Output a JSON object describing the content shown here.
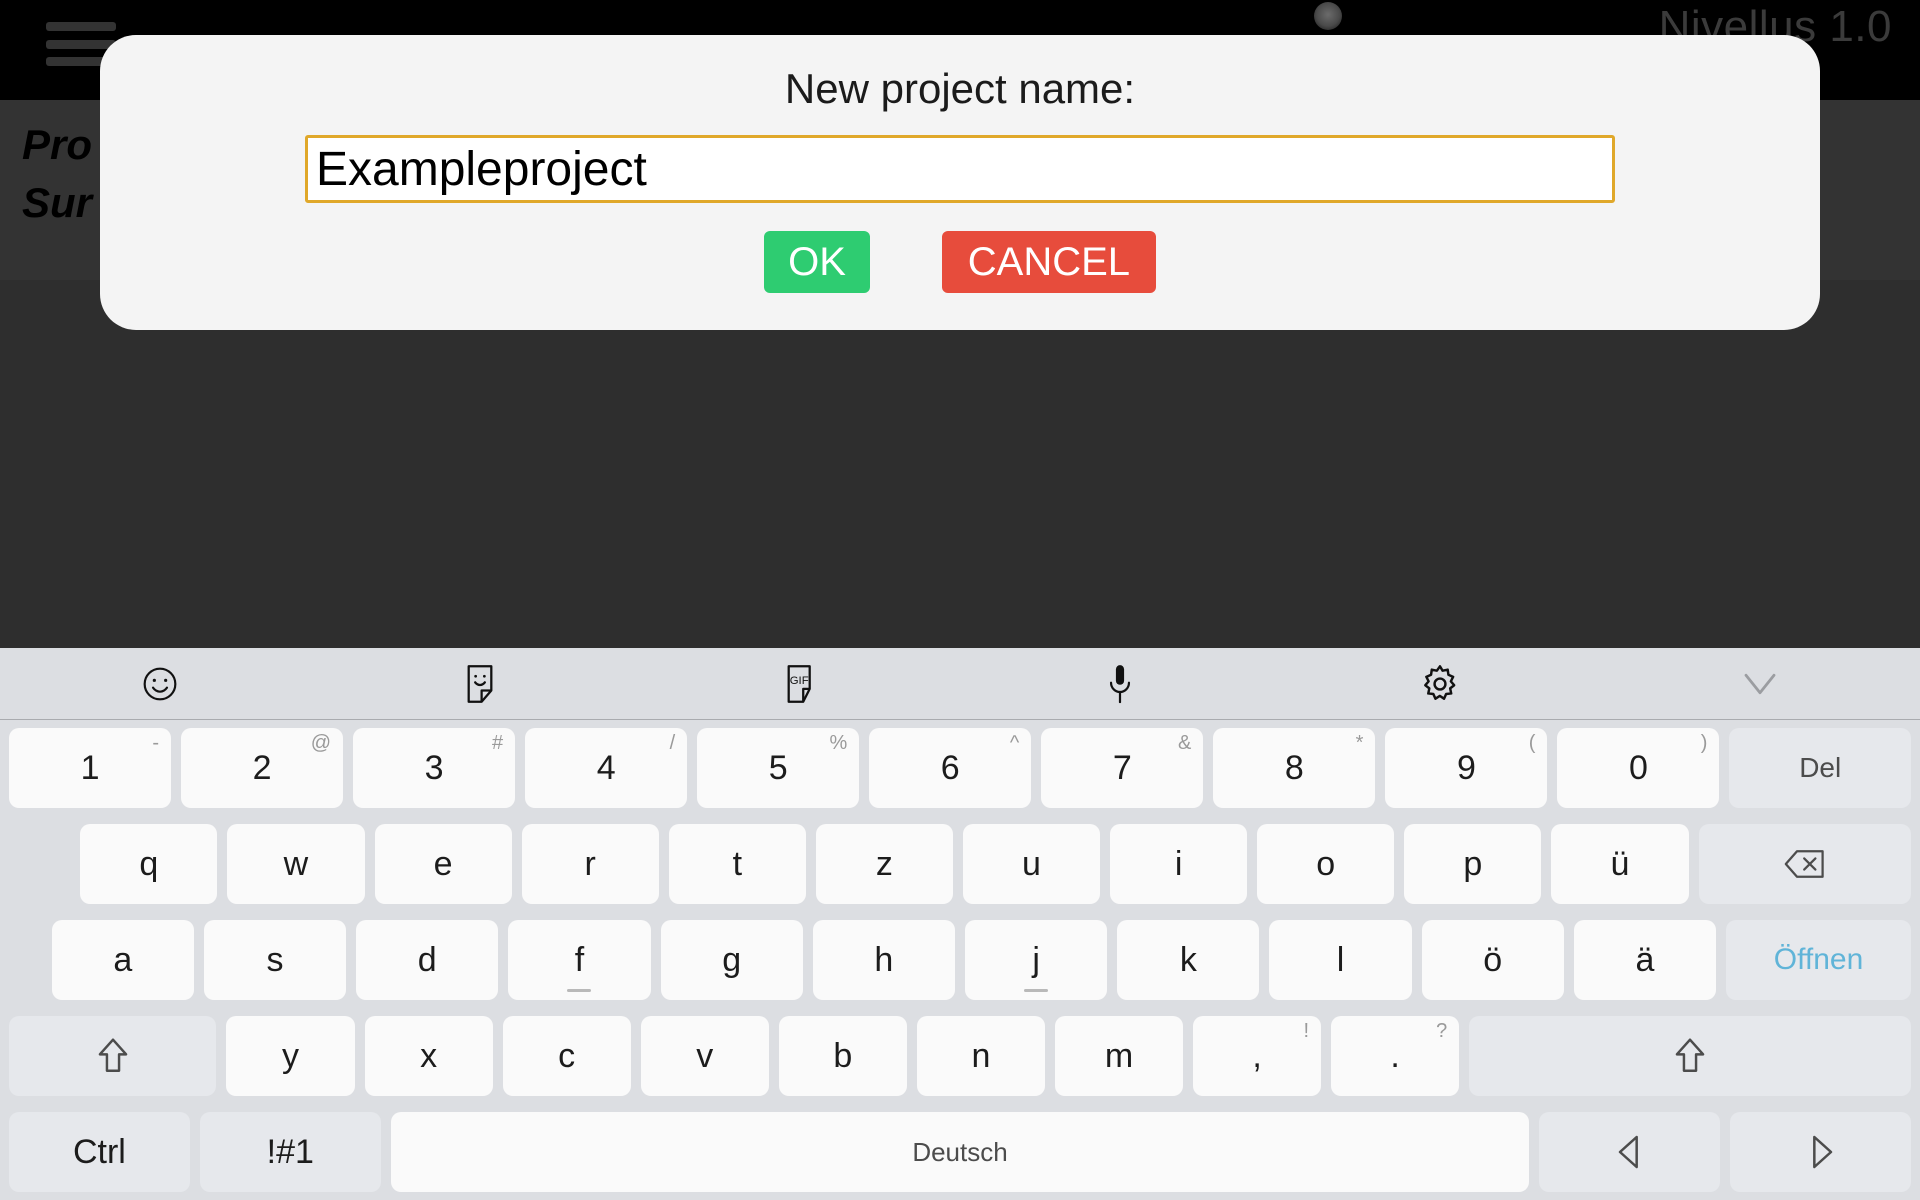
{
  "app": {
    "title": "Nivellus 1.0",
    "menu_icon": "hamburger-icon",
    "header_line1": "Pro",
    "header_line2": "Sur"
  },
  "dialog": {
    "title": "New project name:",
    "input_value": "Exampleproject",
    "input_placeholder": "",
    "ok_label": "OK",
    "cancel_label": "CANCEL",
    "ok_color": "#2ecc71",
    "cancel_color": "#e74c3c",
    "input_border_color": "#e0a82a"
  },
  "keyboard": {
    "language_label": "Deutsch",
    "toolbar": [
      {
        "name": "emoji-icon",
        "label": "emoji"
      },
      {
        "name": "sticker-icon",
        "label": "sticker"
      },
      {
        "name": "gif-icon",
        "label": "GIF"
      },
      {
        "name": "microphone-icon",
        "label": "microphone"
      },
      {
        "name": "gear-icon",
        "label": "settings"
      },
      {
        "name": "chevron-down-icon",
        "label": "hide keyboard"
      }
    ],
    "row_numbers": [
      {
        "main": "1",
        "sup": "-"
      },
      {
        "main": "2",
        "sup": "@"
      },
      {
        "main": "3",
        "sup": "#"
      },
      {
        "main": "4",
        "sup": "/"
      },
      {
        "main": "5",
        "sup": "%"
      },
      {
        "main": "6",
        "sup": "^"
      },
      {
        "main": "7",
        "sup": "&"
      },
      {
        "main": "8",
        "sup": "*"
      },
      {
        "main": "9",
        "sup": "("
      },
      {
        "main": "0",
        "sup": ")"
      }
    ],
    "del_label": "Del",
    "row_top": [
      "q",
      "w",
      "e",
      "r",
      "t",
      "z",
      "u",
      "i",
      "o",
      "p",
      "ü"
    ],
    "row_home": [
      "a",
      "s",
      "d",
      "f",
      "g",
      "h",
      "j",
      "k",
      "l",
      "ö",
      "ä"
    ],
    "enter_label": "Öffnen",
    "row_bottom": [
      "y",
      "x",
      "c",
      "v",
      "b",
      "n",
      "m"
    ],
    "comma": {
      "main": ",",
      "sup": "!"
    },
    "period": {
      "main": ".",
      "sup": "?"
    },
    "ctrl_label": "Ctrl",
    "symbols_label": "!#1",
    "backspace_icon": "backspace-icon",
    "shift_left_icon": "shift-up-icon",
    "shift_right_icon": "shift-up-icon",
    "arrow_left_icon": "arrow-left-icon",
    "arrow_right_icon": "arrow-right-icon",
    "home_row_markers": [
      "f",
      "j"
    ]
  }
}
